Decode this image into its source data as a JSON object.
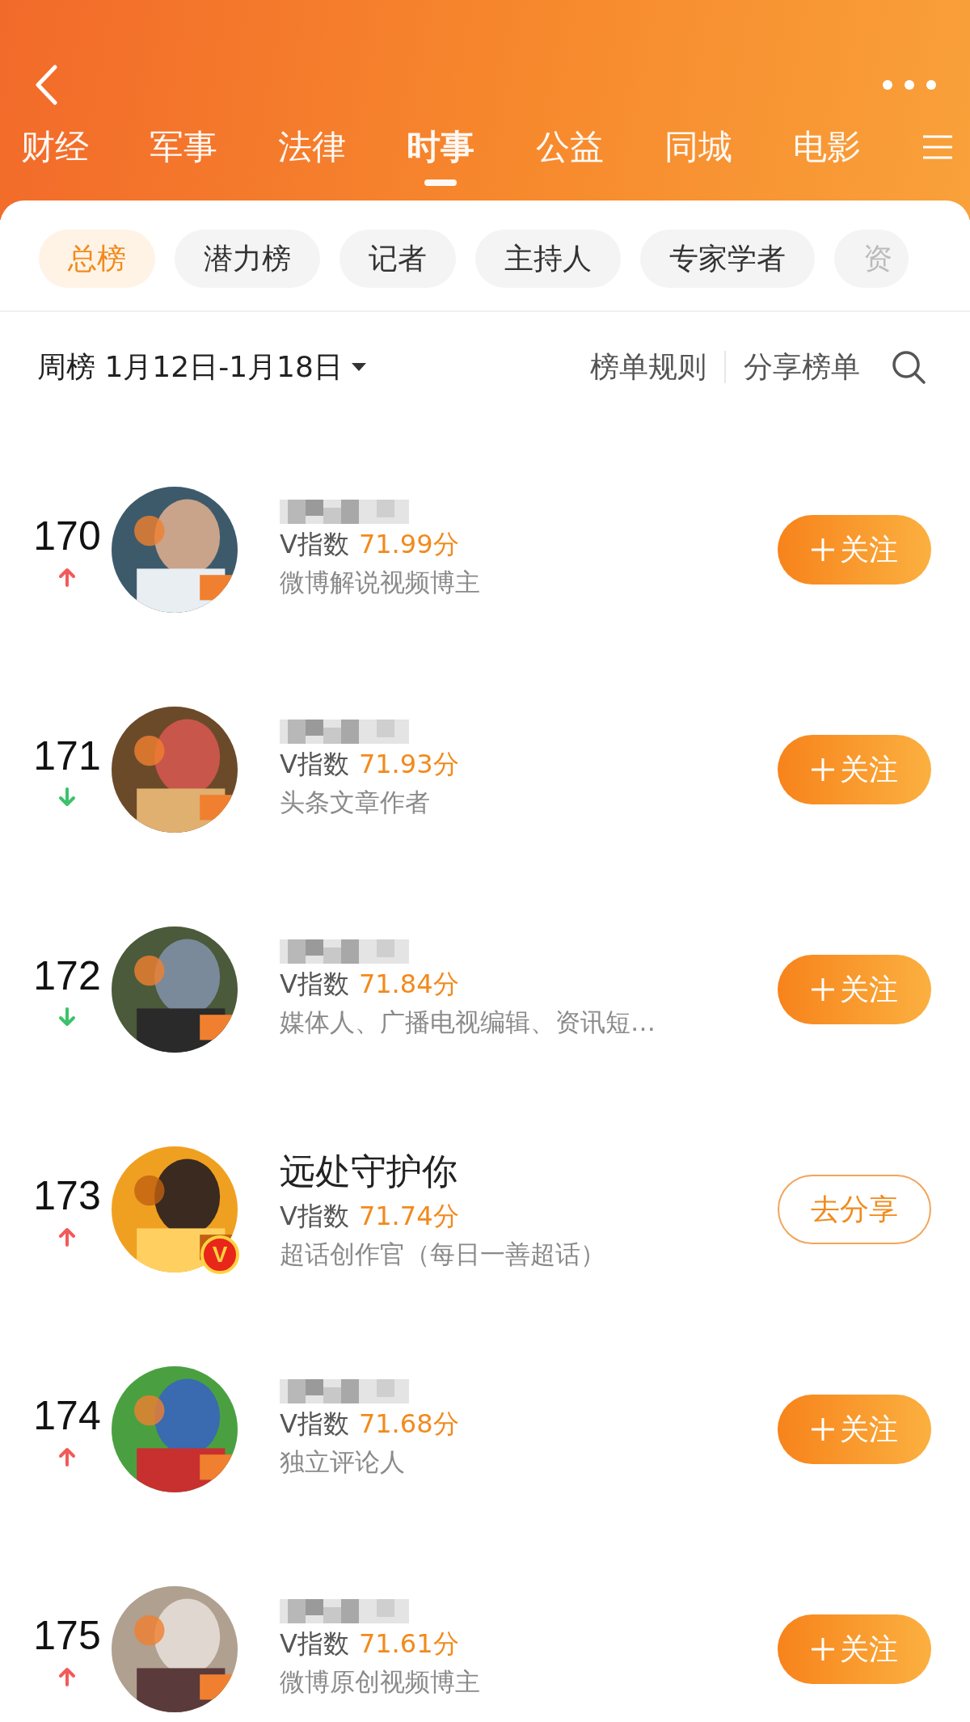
{
  "tabs": [
    {
      "label": "财经",
      "selected": false
    },
    {
      "label": "军事",
      "selected": false
    },
    {
      "label": "法律",
      "selected": false
    },
    {
      "label": "时事",
      "selected": true
    },
    {
      "label": "公益",
      "selected": false
    },
    {
      "label": "同城",
      "selected": false
    },
    {
      "label": "电影",
      "selected": false
    }
  ],
  "chips": [
    {
      "label": "总榜",
      "selected": true
    },
    {
      "label": "潜力榜",
      "selected": false
    },
    {
      "label": "记者",
      "selected": false
    },
    {
      "label": "主持人",
      "selected": false
    },
    {
      "label": "专家学者",
      "selected": false
    },
    {
      "label": "资",
      "selected": false
    }
  ],
  "filter": {
    "period": "周榜 1月12日-1月18日",
    "rules": "榜单规则",
    "share": "分享榜单"
  },
  "rows": [
    {
      "rank": "170",
      "rising": true,
      "name_hidden": true,
      "index_label": "V指数",
      "score": "71.99分",
      "description": "微博解说视频博主",
      "verified": false,
      "button": {
        "kind": "follow",
        "label": "关注"
      }
    },
    {
      "rank": "171",
      "rising": false,
      "name_hidden": true,
      "index_label": "V指数",
      "score": "71.93分",
      "description": "头条文章作者",
      "verified": false,
      "button": {
        "kind": "follow",
        "label": "关注"
      }
    },
    {
      "rank": "172",
      "rising": false,
      "name_hidden": true,
      "index_label": "V指数",
      "score": "71.84分",
      "description": "媒体人、广播电视编辑、资讯短…",
      "verified": false,
      "button": {
        "kind": "follow",
        "label": "关注"
      }
    },
    {
      "rank": "173",
      "rising": true,
      "name": "远处守护你",
      "index_label": "V指数",
      "score": "71.74分",
      "description": "超话创作官（每日一善超话）",
      "verified": true,
      "badge": "V",
      "button": {
        "kind": "share",
        "label": "去分享"
      }
    },
    {
      "rank": "174",
      "rising": true,
      "name_hidden": true,
      "index_label": "V指数",
      "score": "71.68分",
      "description": "独立评论人",
      "verified": false,
      "button": {
        "kind": "follow",
        "label": "关注"
      }
    },
    {
      "rank": "175",
      "rising": true,
      "name_hidden": true,
      "index_label": "V指数",
      "score": "71.61分",
      "description": "微博原创视频博主",
      "verified": false,
      "button": {
        "kind": "follow",
        "label": "关注"
      }
    }
  ]
}
